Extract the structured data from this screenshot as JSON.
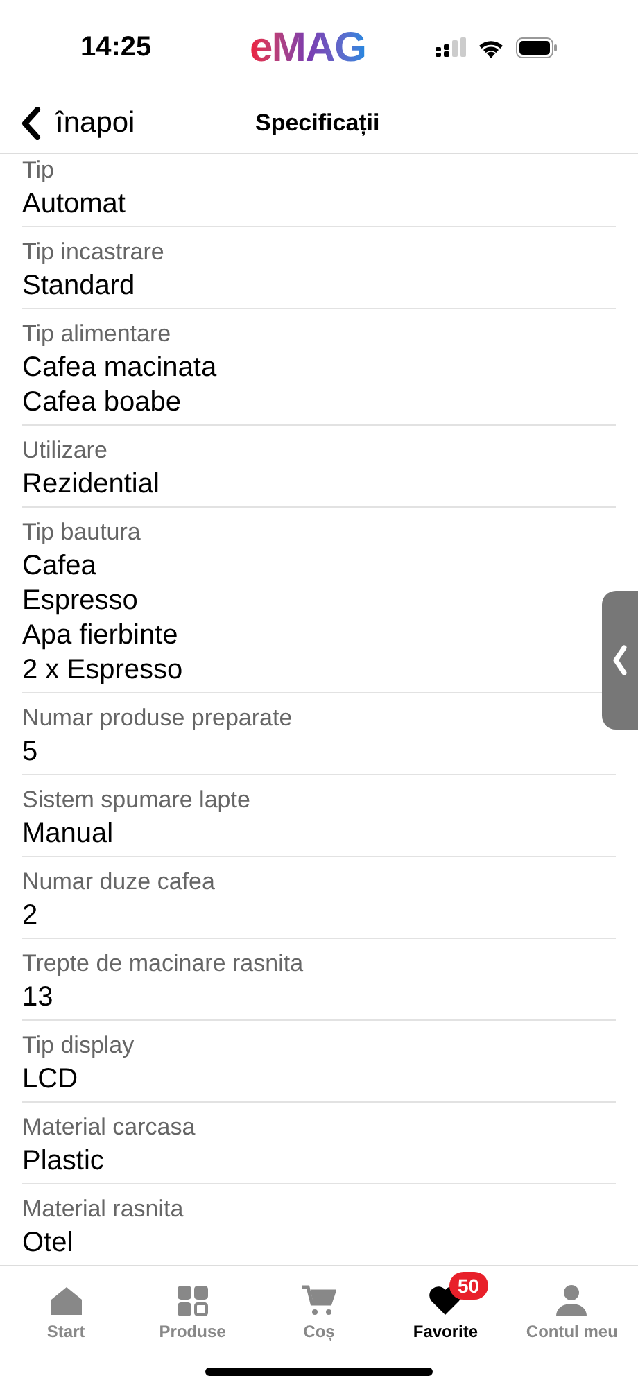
{
  "status_bar": {
    "time": "14:25",
    "logo": "eMAG"
  },
  "header": {
    "back_label": "înapoi",
    "title": "Specificații"
  },
  "specs": [
    {
      "label": "Tip",
      "values": [
        "Automat"
      ]
    },
    {
      "label": "Tip incastrare",
      "values": [
        "Standard"
      ]
    },
    {
      "label": "Tip alimentare",
      "values": [
        "Cafea macinata",
        "Cafea boabe"
      ]
    },
    {
      "label": "Utilizare",
      "values": [
        "Rezidential"
      ]
    },
    {
      "label": "Tip bautura",
      "values": [
        "Cafea",
        "Espresso",
        "Apa fierbinte",
        "2 x Espresso"
      ]
    },
    {
      "label": "Numar produse preparate",
      "values": [
        "5"
      ]
    },
    {
      "label": "Sistem spumare lapte",
      "values": [
        "Manual"
      ]
    },
    {
      "label": "Numar duze cafea",
      "values": [
        "2"
      ]
    },
    {
      "label": "Trepte de macinare rasnita",
      "values": [
        "13"
      ]
    },
    {
      "label": "Tip display",
      "values": [
        "LCD"
      ]
    },
    {
      "label": "Material carcasa",
      "values": [
        "Plastic"
      ]
    },
    {
      "label": "Material rasnita",
      "values": [
        "Otel"
      ]
    }
  ],
  "nav": [
    {
      "kind": "home",
      "label": "Start",
      "selected": false
    },
    {
      "kind": "grid",
      "label": "Produse",
      "selected": false
    },
    {
      "kind": "cart",
      "label": "Coș",
      "selected": false
    },
    {
      "kind": "heart",
      "label": "Favorite",
      "selected": true,
      "badge": "50"
    },
    {
      "kind": "person",
      "label": "Contul meu",
      "selected": false
    }
  ]
}
